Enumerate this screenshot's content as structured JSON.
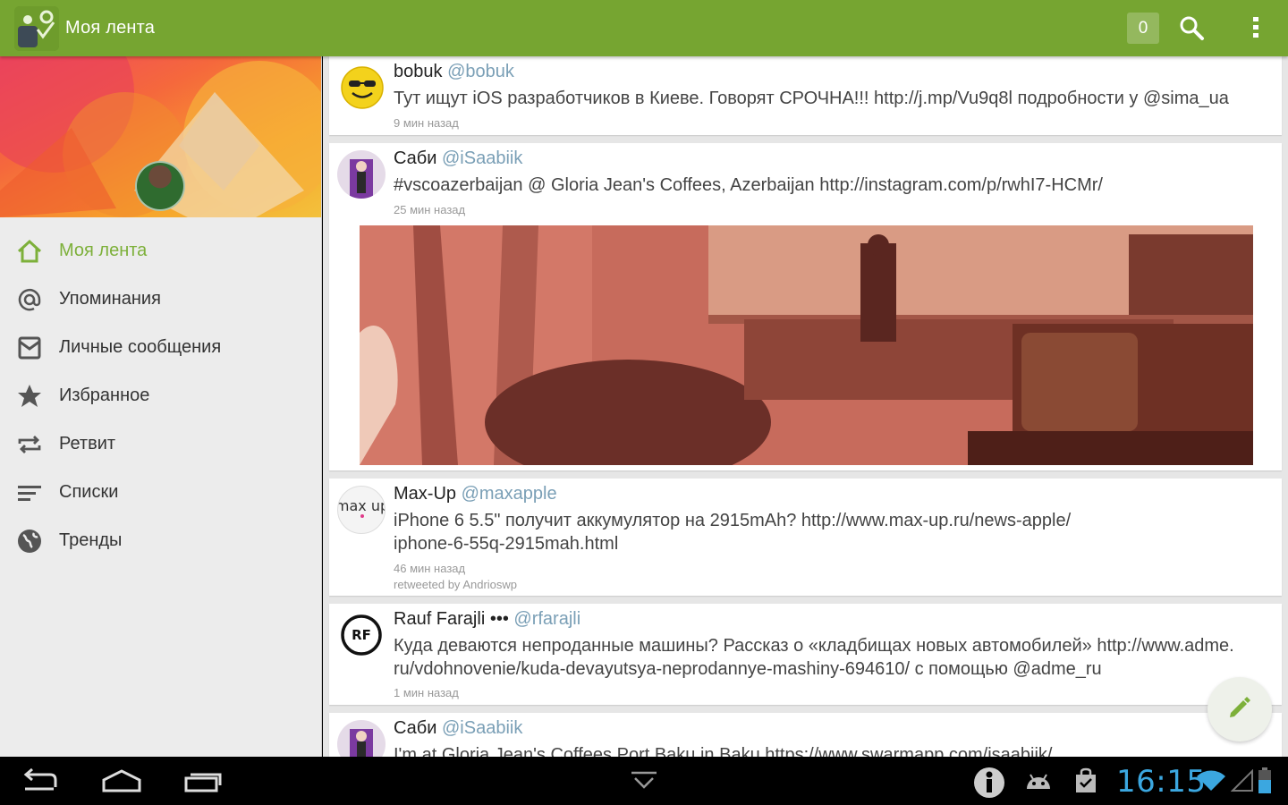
{
  "app": {
    "title": "Моя лента",
    "notification_count": "0"
  },
  "drawer": {
    "items": [
      {
        "label": "Моя лента",
        "icon": "home-icon",
        "active": true
      },
      {
        "label": "Упоминания",
        "icon": "at-icon"
      },
      {
        "label": "Личные сообщения",
        "icon": "mail-icon"
      },
      {
        "label": "Избранное",
        "icon": "star-icon"
      },
      {
        "label": "Ретвит",
        "icon": "retweet-icon"
      },
      {
        "label": "Списки",
        "icon": "lists-icon"
      },
      {
        "label": "Тренды",
        "icon": "globe-icon"
      }
    ]
  },
  "feed": {
    "tweets": [
      {
        "name": "bobuk",
        "handle": "@bobuk",
        "text": "Тут ищут iOS разработчиков в Киеве. Говорят СРОЧНА!!! http://j.mp/Vu9q8l подробности у @sima_ua",
        "time": "9 мин назад"
      },
      {
        "name": "Саби",
        "handle": "@iSaabiik",
        "text": "#vscoazerbaijan @ Gloria Jean's Coffees, Azerbaijan http://instagram.com/p/rwhI7-HCMr/",
        "time": "25 мин назад"
      },
      {
        "name": "Max-Up",
        "handle": "@maxapple",
        "text_line1": "iPhone 6 5.5\" получит аккумулятор на 2915mAh? http://www.max-up.ru/news-apple/",
        "text_line2": "iphone-6-55q-2915mah.html",
        "time": "46 мин назад",
        "retweeted": "retweeted by Andrioswp",
        "avatar_text": "max up"
      },
      {
        "name": "Rauf Farajli •••",
        "handle": "@rfarajli",
        "text_line1": "Куда деваются непроданные машины? Рассказ о «кладбищах новых автомобилей» http://www.adme.",
        "text_line2": "ru/vdohnovenie/kuda-devayutsya-neprodannye-mashiny-694610/ с помощью @adme_ru",
        "time": "1 мин назад",
        "avatar_text": "RF"
      },
      {
        "name": "Саби",
        "handle": "@iSaabiik",
        "text": "I'm at Gloria Jean's Coffees Port Baku in Baku https://www.swarmapp.com/isaabiik/"
      }
    ]
  },
  "system": {
    "clock": "16:15"
  },
  "colors": {
    "accent": "#76a531",
    "active_nav": "#7db03a",
    "handle": "#7a9fb6",
    "clock": "#3ba7e0"
  }
}
